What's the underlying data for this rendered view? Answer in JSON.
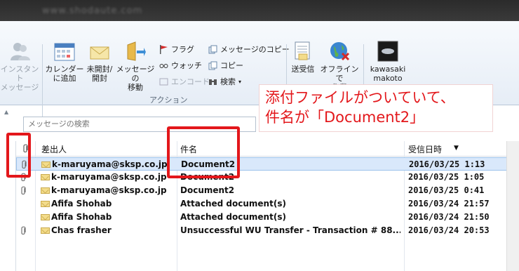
{
  "titlebar": {
    "text": "www.shodaute.com"
  },
  "ribbon": {
    "instant_message": "インスタント\nメッセージ",
    "calendar": "カレンダー\nに追加",
    "unread": "未開封/\n開封",
    "move": "メッセージの\n移動",
    "flag": "フラグ",
    "watch": "ウォッチ",
    "encode": "エンコード",
    "copy_message": "メッセージのコピー",
    "copy": "コピー",
    "find": "検索",
    "actions_group": "アクション",
    "send_receive": "送受信",
    "offline": "オフラインで\n作業",
    "user": "kawasaki\nmakoto"
  },
  "search": {
    "placeholder": "メッセージの検索"
  },
  "columns": {
    "from": "差出人",
    "subject": "件名",
    "received": "受信日時"
  },
  "emails": [
    {
      "attachment": true,
      "from": "k-maruyama@sksp.co.jp",
      "subject": "Document2",
      "date": "2016/03/25 1:13",
      "selected": true
    },
    {
      "attachment": true,
      "from": "k-maruyama@sksp.co.jp",
      "subject": "Document2",
      "date": "2016/03/25 1:05",
      "selected": false
    },
    {
      "attachment": true,
      "from": "k-maruyama@sksp.co.jp",
      "subject": "Document2",
      "date": "2016/03/25 0:41",
      "selected": false
    },
    {
      "attachment": false,
      "from": "Afifa Shohab",
      "subject": "Attached document(s)",
      "date": "2016/03/24 21:57",
      "selected": false
    },
    {
      "attachment": false,
      "from": "Afifa Shohab",
      "subject": "Attached document(s)",
      "date": "2016/03/24 21:50",
      "selected": false
    },
    {
      "attachment": true,
      "from": "Chas frasher",
      "subject": "Unsuccessful WU Transfer - Transaction # 88...",
      "date": "2016/03/24 20:53",
      "selected": false
    }
  ],
  "annotation": {
    "line1": "添付ファイルがついていて、",
    "line2": "件名が「Document2」"
  },
  "colors": {
    "annotation": "#e3171b",
    "selection": "#d9e8fb"
  }
}
